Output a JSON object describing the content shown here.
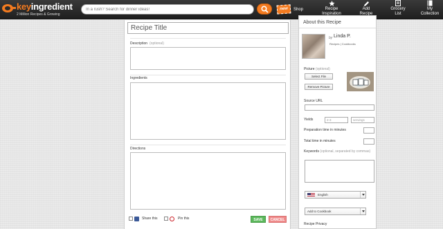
{
  "header": {
    "logo_word_orange": "key",
    "logo_word_white": "ingredient",
    "logo_tagline": "2 Million Recipes & Growing",
    "search_placeholder": "In a rush? Search for dinner ideas!",
    "new_badge": "new",
    "nav": [
      {
        "label": "Shop"
      },
      {
        "label1": "Recipe",
        "label2": "Inspiration"
      },
      {
        "label1": "Add",
        "label2": "Recipe"
      },
      {
        "label1": "Grocery",
        "label2": "List"
      },
      {
        "label1": "My",
        "label2": "Collection"
      }
    ]
  },
  "form": {
    "title_placeholder": "Recipe Title",
    "description_label": "Description",
    "description_hint": "(optional)",
    "ingredients_label": "Ingredients",
    "directions_label": "Directions",
    "share_this": "Share this",
    "pin_this": "Pin this",
    "save_label": "SAVE",
    "cancel_label": "CANCEL"
  },
  "sidebar": {
    "title": "About this Recipe",
    "by": "by",
    "author_name": "Linda P.",
    "author_links": "Recipes | Cookbooks",
    "picture_label": "Picture",
    "picture_hint": "(optional)",
    "select_file": "Select File",
    "remove_picture": "Remove Picture",
    "source_url_label": "Source URL",
    "yields_label": "Yields",
    "yields_value_placeholder": "2-3",
    "yields_unit_placeholder": "servings",
    "prep_time_label": "Preparation time in minutes",
    "total_time_label": "Total time in minutes",
    "keywords_label": "Keywords",
    "keywords_hint": "(optional, separated by commas)",
    "language_selected": "English",
    "cookbook_selected": "Add to Cookbook",
    "privacy_label": "Recipe Privacy"
  },
  "colors": {
    "brand_orange": "#f47b20",
    "save_green": "#5cb85c",
    "cancel_red": "#ef8a8a",
    "topbar_dark": "#2a2a2a"
  }
}
